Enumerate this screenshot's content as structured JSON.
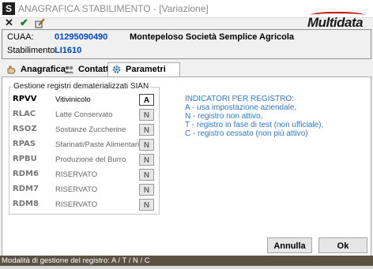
{
  "window": {
    "title": "ANAGRAFICA STABILIMENTO - [Variazione]",
    "app_icon_letter": "S"
  },
  "toolbar": {
    "buttons": [
      "close",
      "confirm",
      "edit"
    ]
  },
  "logo": {
    "text": "Multidata"
  },
  "header": {
    "cuaa_label": "CUAA:",
    "cuaa_value": "01295090490",
    "company_name": "Montepeloso Società Semplice Agricola",
    "stabilimento_label": "Stabilimento:",
    "stabilimento_value": "LI1610"
  },
  "tabs": [
    {
      "label": "Anagrafica",
      "active": false
    },
    {
      "label": "Contatti",
      "active": false
    },
    {
      "label": "Parametri SIAN",
      "active": true
    }
  ],
  "group": {
    "title": "Gestione registri dematerializzati SIAN",
    "registers": [
      {
        "code": "RPVV",
        "desc": "Vitivinicolo",
        "value": "A",
        "active": true
      },
      {
        "code": "RLAC",
        "desc": "Latte Conservato",
        "value": "N",
        "active": false
      },
      {
        "code": "RSOZ",
        "desc": "Sostanze Zuccherine",
        "value": "N",
        "active": false
      },
      {
        "code": "RPAS",
        "desc": "Sfarinati/Paste Alimentari",
        "value": "N",
        "active": false
      },
      {
        "code": "RPBU",
        "desc": "Produzione del Burro",
        "value": "N",
        "active": false
      },
      {
        "code": "RDM6",
        "desc": "RISERVATO",
        "value": "N",
        "active": false
      },
      {
        "code": "RDM7",
        "desc": "RISERVATO",
        "value": "N",
        "active": false
      },
      {
        "code": "RDM8",
        "desc": "RISERVATO",
        "value": "N",
        "active": false
      }
    ]
  },
  "indicators": {
    "title": "INDICATORI PER REGISTRO:",
    "lines": [
      "A - usa impostazione aziendale,",
      "N - registro non attivo,",
      "T - registro in fase di test (non ufficiale),",
      "C - registro cessato (non più attivo)"
    ]
  },
  "buttons": {
    "cancel": "Annulla",
    "ok": "Ok"
  },
  "status": {
    "text": "Modalità di gestione del registro: A / T / N / C"
  },
  "colors": {
    "accent_blue": "#0046d5",
    "indicator_blue": "#2c79d6",
    "status_bar": "#5b5244",
    "logo_red": "#c00000"
  }
}
